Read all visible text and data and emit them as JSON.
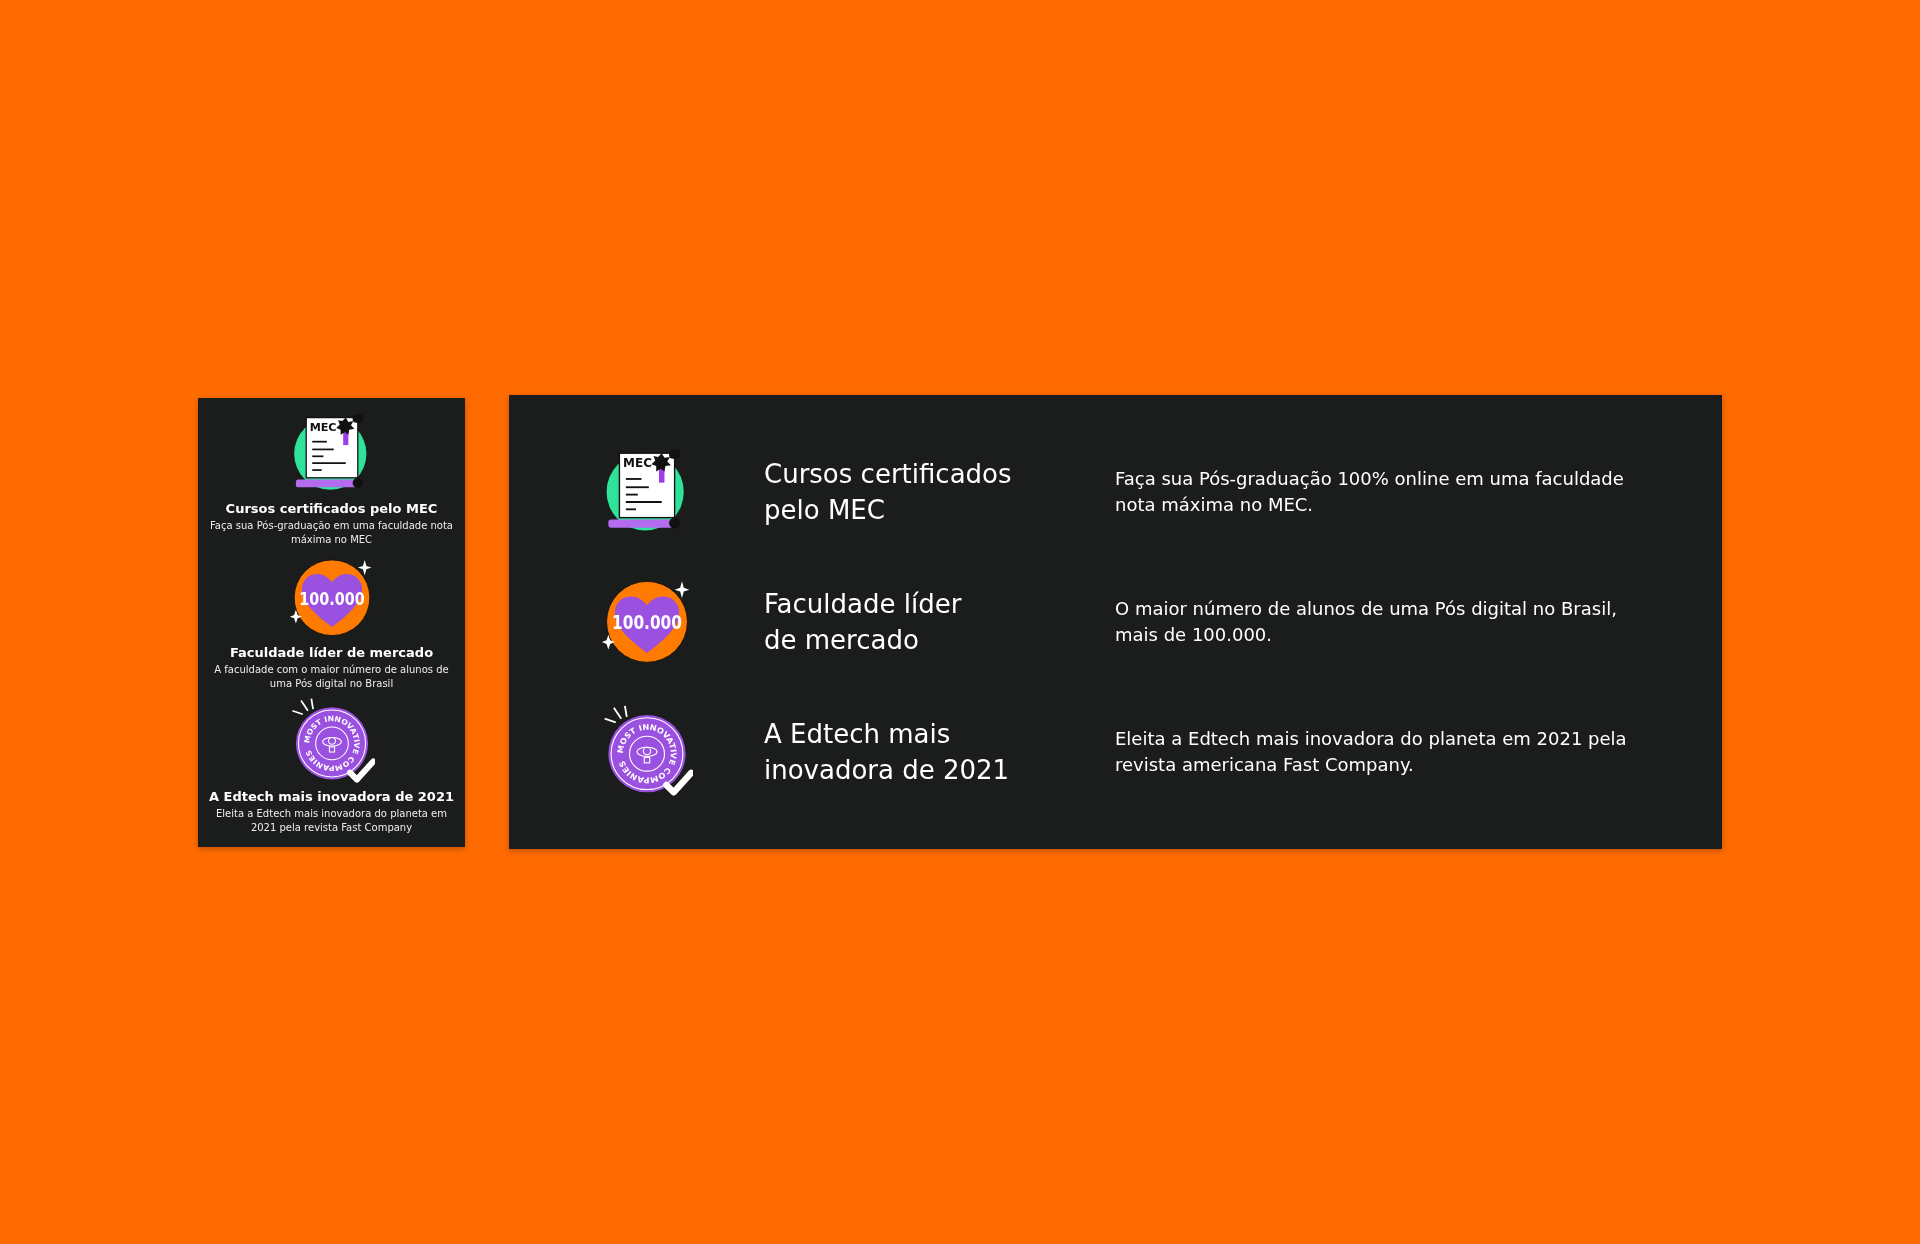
{
  "mobile": {
    "items": [
      {
        "kind": "certificate",
        "badge": "MEC",
        "title": "Cursos certificados pelo MEC",
        "description": "Faça sua Pós-graduação em uma faculdade nota máxima no MEC"
      },
      {
        "kind": "heart",
        "badge": "100.000",
        "title": "Faculdade líder de mercado",
        "description": "A faculdade com o maior número de alunos de uma Pós digital no Brasil"
      },
      {
        "kind": "seal",
        "badge": "MOST INNOVATIVE COMPANIES",
        "title": "A Edtech mais inovadora de 2021",
        "description": "Eleita a Edtech mais inovadora do planeta em 2021 pela revista Fast Company"
      }
    ]
  },
  "desktop": {
    "items": [
      {
        "kind": "certificate",
        "badge": "MEC",
        "title_lines": [
          "Cursos certificados",
          "pelo MEC"
        ],
        "description": "Faça sua Pós-graduação 100% online em uma faculdade nota máxima no MEC."
      },
      {
        "kind": "heart",
        "badge": "100.000",
        "title_lines": [
          "Faculdade líder",
          "de mercado"
        ],
        "description": "O maior número de alunos de uma Pós digital no Brasil, mais de 100.000."
      },
      {
        "kind": "seal",
        "badge": "MOST INNOVATIVE COMPANIES",
        "title_lines": [
          "A Edtech mais",
          "inovadora de 2021"
        ],
        "description": "Eleita a Edtech mais inovadora do planeta em 2021 pela revista americana Fast Company."
      }
    ]
  }
}
